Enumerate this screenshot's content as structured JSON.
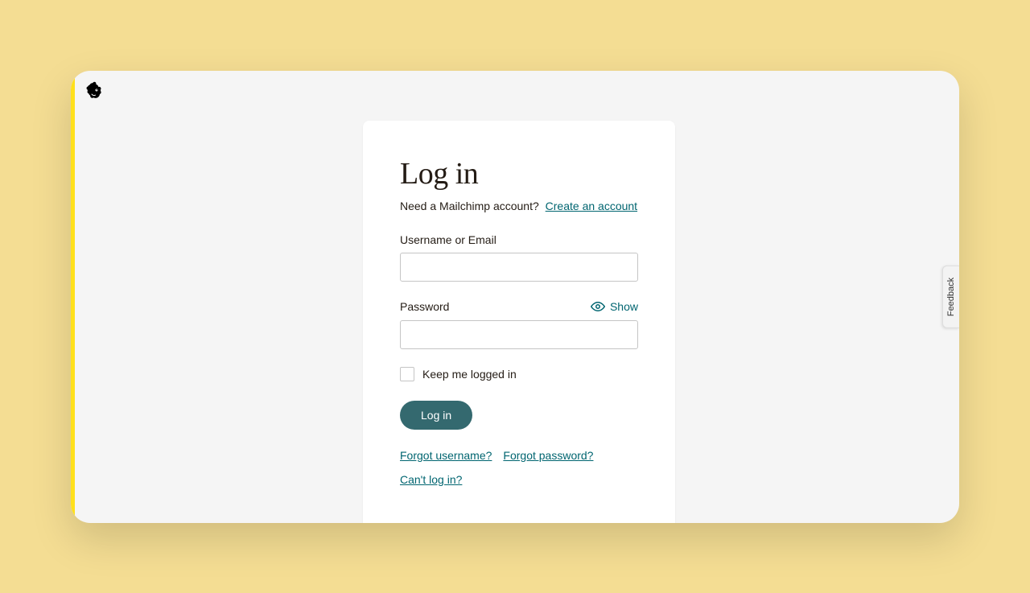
{
  "login": {
    "title": "Log in",
    "subtitle_text": "Need a Mailchimp account?",
    "create_account_link": "Create an account",
    "username_label": "Username or Email",
    "password_label": "Password",
    "show_label": "Show",
    "keep_logged_in_label": "Keep me logged in",
    "submit_button": "Log in",
    "forgot_username": "Forgot username?",
    "forgot_password": "Forgot password?",
    "cant_login": "Can't log in?"
  },
  "feedback": {
    "label": "Feedback"
  }
}
